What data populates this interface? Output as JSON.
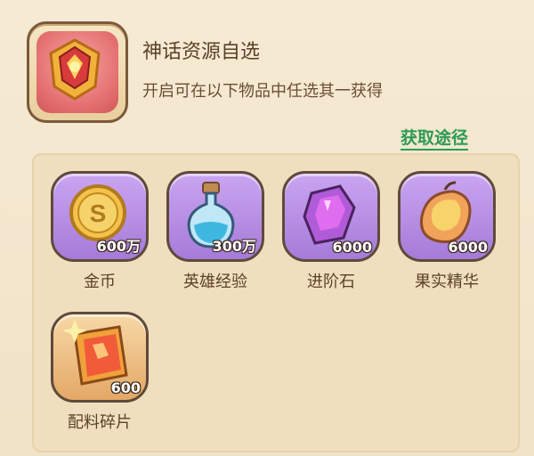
{
  "header": {
    "title": "神话资源自选",
    "subtitle": "开启可在以下物品中任选其一获得",
    "link": "获取途径"
  },
  "items": [
    {
      "name": "金币",
      "qty": "600万",
      "icon": "gold-coin-icon"
    },
    {
      "name": "英雄经验",
      "qty": "300万",
      "icon": "potion-icon"
    },
    {
      "name": "进阶石",
      "qty": "6000",
      "icon": "crystal-icon"
    },
    {
      "name": "果实精华",
      "qty": "6000",
      "icon": "fruit-icon"
    },
    {
      "name": "配料碎片",
      "qty": "600",
      "icon": "fragment-icon"
    }
  ],
  "colors": {
    "link": "#2d9b54",
    "text": "#5b4129",
    "purple_frame": "#a57bd8",
    "orange_frame": "#e4a866"
  }
}
